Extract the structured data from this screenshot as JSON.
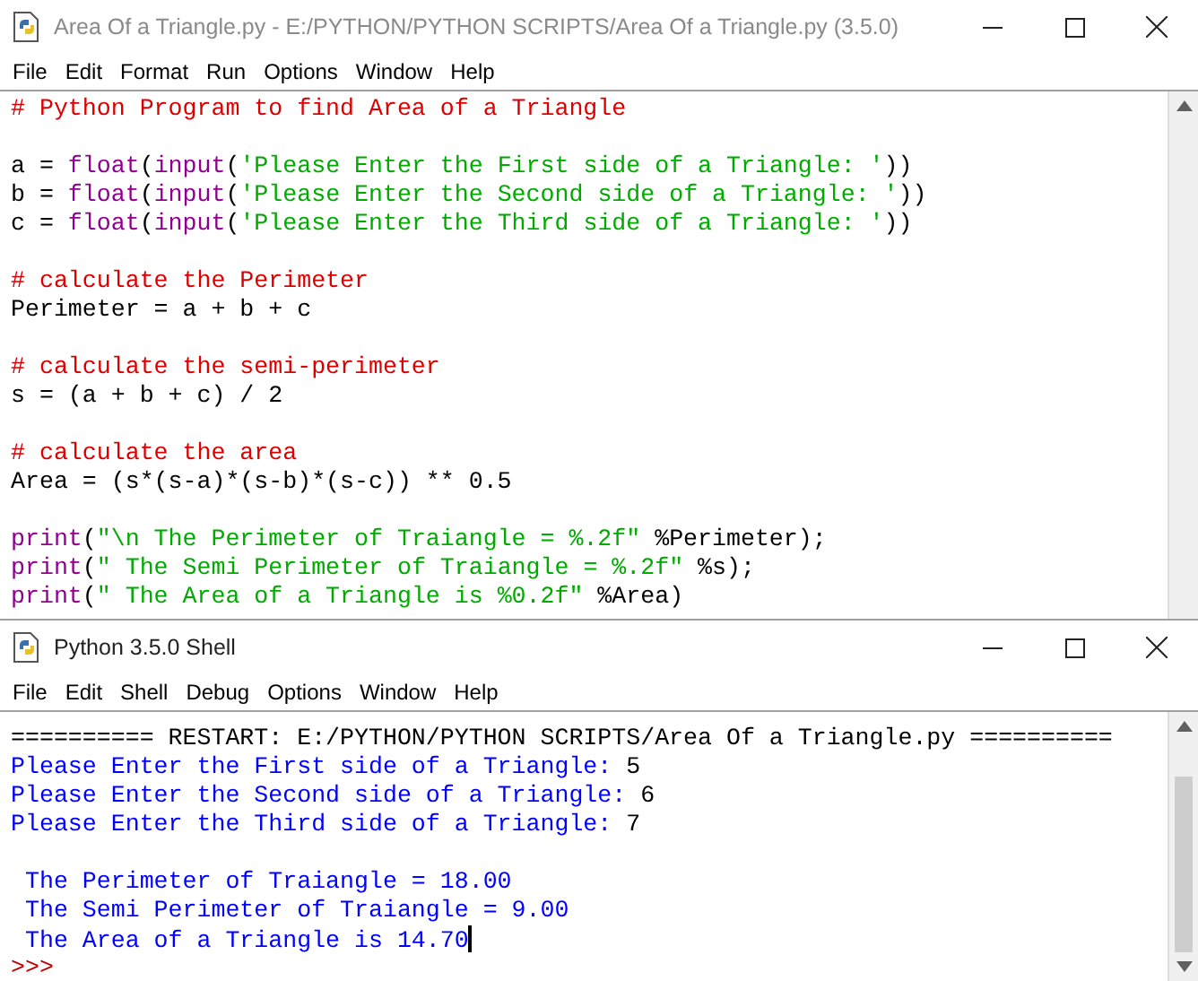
{
  "editor": {
    "title": "Area Of a Triangle.py - E:/PYTHON/PYTHON SCRIPTS/Area Of a Triangle.py (3.5.0)",
    "menu": [
      "File",
      "Edit",
      "Format",
      "Run",
      "Options",
      "Window",
      "Help"
    ],
    "lines": [
      {
        "kind": "code",
        "tokens": [
          {
            "kind": "comment",
            "text": "# Python Program to find Area of a Triangle"
          }
        ]
      },
      {
        "kind": "blank"
      },
      {
        "kind": "code",
        "tokens": [
          {
            "kind": "plain",
            "text": "a = "
          },
          {
            "kind": "builtin",
            "text": "float"
          },
          {
            "kind": "plain",
            "text": "("
          },
          {
            "kind": "builtin",
            "text": "input"
          },
          {
            "kind": "plain",
            "text": "("
          },
          {
            "kind": "string",
            "text": "'Please Enter the First side of a Triangle: '"
          },
          {
            "kind": "plain",
            "text": "))"
          }
        ]
      },
      {
        "kind": "code",
        "tokens": [
          {
            "kind": "plain",
            "text": "b = "
          },
          {
            "kind": "builtin",
            "text": "float"
          },
          {
            "kind": "plain",
            "text": "("
          },
          {
            "kind": "builtin",
            "text": "input"
          },
          {
            "kind": "plain",
            "text": "("
          },
          {
            "kind": "string",
            "text": "'Please Enter the Second side of a Triangle: '"
          },
          {
            "kind": "plain",
            "text": "))"
          }
        ]
      },
      {
        "kind": "code",
        "tokens": [
          {
            "kind": "plain",
            "text": "c = "
          },
          {
            "kind": "builtin",
            "text": "float"
          },
          {
            "kind": "plain",
            "text": "("
          },
          {
            "kind": "builtin",
            "text": "input"
          },
          {
            "kind": "plain",
            "text": "("
          },
          {
            "kind": "string",
            "text": "'Please Enter the Third side of a Triangle: '"
          },
          {
            "kind": "plain",
            "text": "))"
          }
        ]
      },
      {
        "kind": "blank"
      },
      {
        "kind": "code",
        "tokens": [
          {
            "kind": "comment",
            "text": "# calculate the Perimeter"
          }
        ]
      },
      {
        "kind": "code",
        "tokens": [
          {
            "kind": "plain",
            "text": "Perimeter = a + b + c"
          }
        ]
      },
      {
        "kind": "blank"
      },
      {
        "kind": "code",
        "tokens": [
          {
            "kind": "comment",
            "text": "# calculate the semi-perimeter"
          }
        ]
      },
      {
        "kind": "code",
        "tokens": [
          {
            "kind": "plain",
            "text": "s = (a + b + c) / 2"
          }
        ]
      },
      {
        "kind": "blank"
      },
      {
        "kind": "code",
        "tokens": [
          {
            "kind": "comment",
            "text": "# calculate the area"
          }
        ]
      },
      {
        "kind": "code",
        "tokens": [
          {
            "kind": "plain",
            "text": "Area = (s*(s-a)*(s-b)*(s-c)) ** 0.5"
          }
        ]
      },
      {
        "kind": "blank"
      },
      {
        "kind": "code",
        "tokens": [
          {
            "kind": "builtin",
            "text": "print"
          },
          {
            "kind": "plain",
            "text": "("
          },
          {
            "kind": "string",
            "text": "\"\\n The Perimeter of Traiangle = %.2f\""
          },
          {
            "kind": "plain",
            "text": " %Perimeter);"
          }
        ]
      },
      {
        "kind": "code",
        "tokens": [
          {
            "kind": "builtin",
            "text": "print"
          },
          {
            "kind": "plain",
            "text": "("
          },
          {
            "kind": "string",
            "text": "\" The Semi Perimeter of Traiangle = %.2f\""
          },
          {
            "kind": "plain",
            "text": " %s);"
          }
        ]
      },
      {
        "kind": "code",
        "tokens": [
          {
            "kind": "builtin",
            "text": "print"
          },
          {
            "kind": "plain",
            "text": "("
          },
          {
            "kind": "string",
            "text": "\" The Area of a Triangle is %0.2f\""
          },
          {
            "kind": "plain",
            "text": " %Area)"
          }
        ]
      }
    ]
  },
  "shell": {
    "title": "Python 3.5.0 Shell",
    "menu": [
      "File",
      "Edit",
      "Shell",
      "Debug",
      "Options",
      "Window",
      "Help"
    ],
    "lines": [
      {
        "kind": "code",
        "tokens": [
          {
            "kind": "info",
            "text": "========== RESTART: E:/PYTHON/PYTHON SCRIPTS/Area Of a Triangle.py =========="
          }
        ]
      },
      {
        "kind": "code",
        "tokens": [
          {
            "kind": "output",
            "text": "Please Enter the First side of a Triangle: "
          },
          {
            "kind": "input",
            "text": "5"
          }
        ]
      },
      {
        "kind": "code",
        "tokens": [
          {
            "kind": "output",
            "text": "Please Enter the Second side of a Triangle: "
          },
          {
            "kind": "input",
            "text": "6"
          }
        ]
      },
      {
        "kind": "code",
        "tokens": [
          {
            "kind": "output",
            "text": "Please Enter the Third side of a Triangle: "
          },
          {
            "kind": "input",
            "text": "7"
          }
        ]
      },
      {
        "kind": "blank"
      },
      {
        "kind": "code",
        "tokens": [
          {
            "kind": "output",
            "text": " The Perimeter of Traiangle = 18.00"
          }
        ]
      },
      {
        "kind": "code",
        "tokens": [
          {
            "kind": "output",
            "text": " The Semi Perimeter of Traiangle = 9.00"
          }
        ]
      },
      {
        "kind": "code",
        "caret": true,
        "tokens": [
          {
            "kind": "output",
            "text": " The Area of a Triangle is 14.70"
          }
        ]
      },
      {
        "kind": "code",
        "tokens": [
          {
            "kind": "prompt",
            "text": ">>>"
          }
        ]
      }
    ]
  }
}
